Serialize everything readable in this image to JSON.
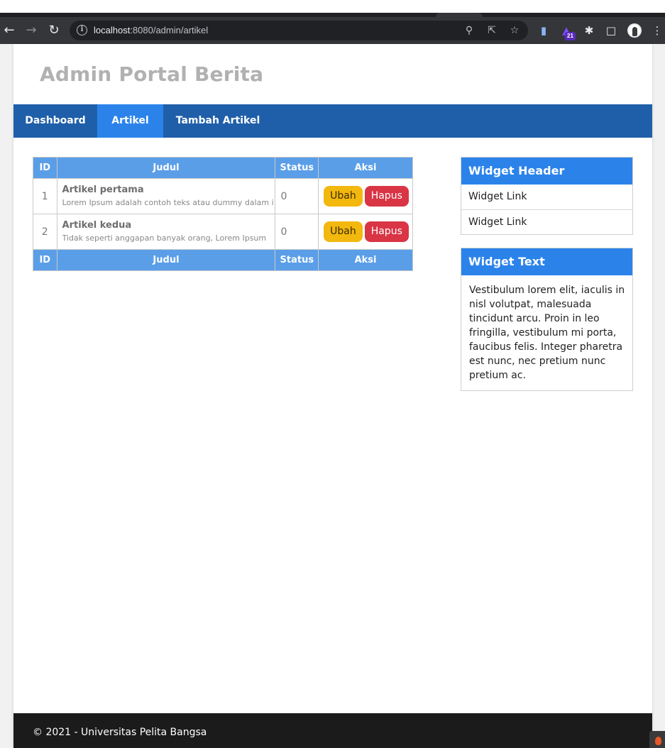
{
  "browser": {
    "url_host": "localhost",
    "url_rest": ":8080/admin/artikel",
    "extension_badge": "21"
  },
  "site": {
    "title": "Admin Portal Berita"
  },
  "nav": {
    "items": [
      {
        "label": "Dashboard"
      },
      {
        "label": "Artikel"
      },
      {
        "label": "Tambah Artikel"
      }
    ]
  },
  "table": {
    "headers": [
      "ID",
      "Judul",
      "Status",
      "Aksi"
    ],
    "footers": [
      "ID",
      "Judul",
      "Status",
      "Aksi"
    ],
    "rows": [
      {
        "id": "1",
        "title": "Artikel pertama",
        "snippet": "Lorem Ipsum adalah contoh teks atau dummy dalam i",
        "status": "0",
        "edit": "Ubah",
        "delete": "Hapus"
      },
      {
        "id": "2",
        "title": "Artikel kedua",
        "snippet": "Tidak seperti anggapan banyak orang, Lorem Ipsum",
        "status": "0",
        "edit": "Ubah",
        "delete": "Hapus"
      }
    ]
  },
  "widgets": {
    "links_header": "Widget Header",
    "links": [
      "Widget Link",
      "Widget Link"
    ],
    "text_header": "Widget Text",
    "text_body": "Vestibulum lorem elit, iaculis in nisl volutpat, malesuada tincidunt arcu. Proin in leo fringilla, vestibulum mi porta, faucibus felis. Integer pharetra est nunc, nec pretium nunc pretium ac."
  },
  "footer": {
    "text": "© 2021 - Universitas Pelita Bangsa"
  },
  "colors": {
    "nav_bg": "#1f5faa",
    "nav_active": "#2b83ea",
    "table_header": "#5a9ee8",
    "btn_ubah": "#f3b80e",
    "btn_hapus": "#d93545",
    "footer_bg": "#1b1b1c"
  }
}
